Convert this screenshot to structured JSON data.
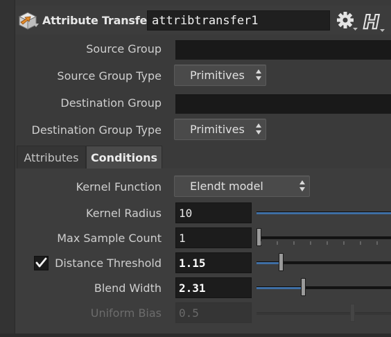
{
  "header": {
    "node_type": "Attribute Transfer",
    "node_name": "attribtransfer1",
    "icons": {
      "node": "attribute-transfer-node-icon",
      "gear": "gear-icon",
      "help": "houdini-help-icon"
    }
  },
  "params": {
    "source_group": {
      "label": "Source Group",
      "value": ""
    },
    "source_group_type": {
      "label": "Source Group Type",
      "value": "Primitives"
    },
    "destination_group": {
      "label": "Destination Group",
      "value": ""
    },
    "destination_group_type": {
      "label": "Destination Group Type",
      "value": "Primitives"
    }
  },
  "tabs": [
    {
      "label": "Attributes",
      "active": false
    },
    {
      "label": "Conditions",
      "active": true
    }
  ],
  "conditions": {
    "kernel_function": {
      "label": "Kernel Function",
      "value": "Elendt model"
    },
    "kernel_radius": {
      "label": "Kernel Radius",
      "value": "10",
      "slider_fraction": 1.0
    },
    "max_sample_count": {
      "label": "Max Sample Count",
      "value": "1",
      "slider_fraction": 0.0
    },
    "distance_threshold": {
      "label": "Distance Threshold",
      "value": "1.15",
      "enabled": true,
      "slider_fraction": 0.17
    },
    "blend_width": {
      "label": "Blend Width",
      "value": "2.31",
      "slider_fraction": 0.34
    },
    "uniform_bias": {
      "label": "Uniform Bias",
      "value": "0.5",
      "disabled": true,
      "slider_fraction": 0.72
    }
  },
  "colors": {
    "slider_fill": "#3f6fa5",
    "background": "#3a3a3a",
    "field": "#1c1c1c"
  }
}
